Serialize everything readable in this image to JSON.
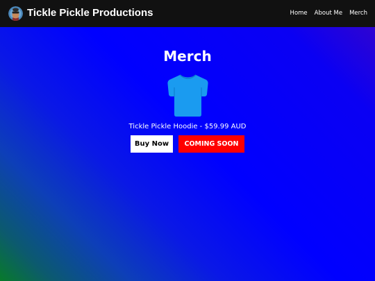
{
  "header": {
    "brand": "Tickle Pickle Productions",
    "logo_icon": "pickle-avatar-icon",
    "nav": [
      {
        "label": "Home"
      },
      {
        "label": "About Me"
      },
      {
        "label": "Merch"
      }
    ]
  },
  "main": {
    "title": "Merch",
    "product": {
      "icon": "t-shirt-icon",
      "name": "Tickle Pickle Hoodie - $59.99 AUD",
      "buy_label": "Buy Now",
      "status_label": "COMING SOON"
    }
  },
  "colors": {
    "header_bg": "#111111",
    "shirt": "#1a9bf0",
    "status_button": "#ff0000",
    "buy_button": "#ffffff"
  }
}
